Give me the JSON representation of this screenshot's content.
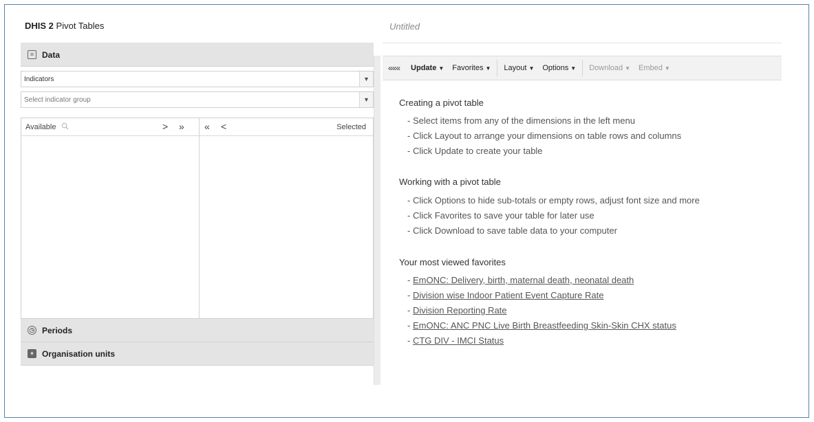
{
  "left_panel": {
    "app_title_bold": "DHIS 2",
    "app_title_rest": "Pivot Tables",
    "data_section": "Data",
    "indicators_combo": "Indicators",
    "indicator_group_placeholder": "Select indicator group",
    "available_label": "Available",
    "selected_label": "Selected",
    "select_one_arrow": ">",
    "select_all_arrow": "»",
    "deselect_all_arrow": "«",
    "deselect_one_arrow": "<",
    "periods_section": "Periods",
    "org_units_section": "Organisation units"
  },
  "right_panel": {
    "title": "Untitled",
    "toolbar": {
      "collapse": "«««",
      "update": "Update",
      "favorites": "Favorites",
      "layout": "Layout",
      "options": "Options",
      "download": "Download",
      "embed": "Embed"
    },
    "creating_heading": "Creating a pivot table",
    "creating_items": [
      "- Select items from any of the dimensions in the left menu",
      "- Click Layout to arrange your dimensions on table rows and columns",
      "- Click Update to create your table"
    ],
    "working_heading": "Working with a pivot table",
    "working_items": [
      "- Click Options to hide sub-totals or empty rows, adjust font size and more",
      "- Click Favorites to save your table for later use",
      "- Click Download to save table data to your computer"
    ],
    "favorites_heading": "Your most viewed favorites",
    "favorites": [
      "EmONC: Delivery, birth, maternal death, neonatal death",
      "Division wise Indoor Patient Event Capture Rate",
      "Division Reporting Rate",
      "EmONC: ANC PNC Live Birth Breastfeeding Skin-Skin CHX status",
      "CTG DIV - IMCI Status"
    ],
    "favorites_prefix": "- "
  },
  "colors": {
    "frame_border": "#5b7fa6",
    "section_bg": "#e4e4e4",
    "toolbar_bg": "#f2f2f2"
  }
}
